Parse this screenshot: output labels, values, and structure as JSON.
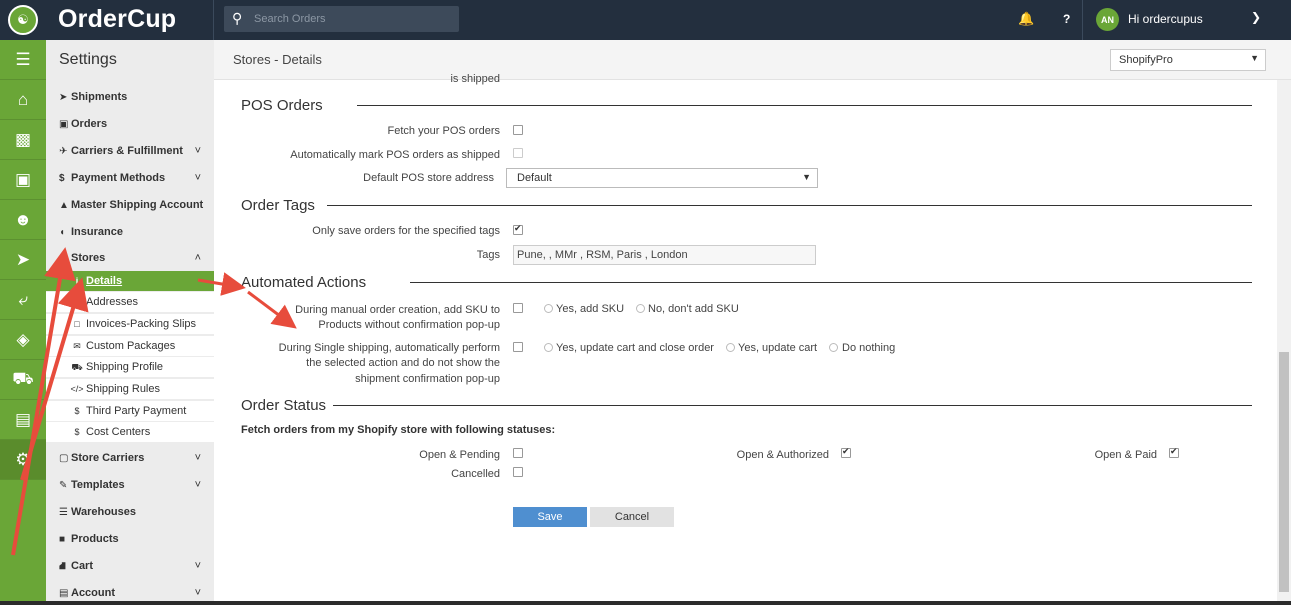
{
  "app": {
    "name": "OrderCup",
    "logo_glyph": "☯"
  },
  "topbar": {
    "search_placeholder": "Search Orders",
    "help": "?",
    "avatar": "AN",
    "greeting": "Hi ordercupus"
  },
  "icons": [
    "menu-icon",
    "home-icon",
    "money-icon",
    "archive-icon",
    "users-icon",
    "rocket-icon",
    "reply-icon",
    "tag-icon",
    "truck-icon",
    "chart-icon",
    "gear-icon"
  ],
  "settings": {
    "title": "Settings",
    "items": [
      {
        "icon": "➤",
        "label": "Shipments"
      },
      {
        "icon": "▣",
        "label": "Orders"
      },
      {
        "icon": "✈",
        "label": "Carriers & Fulfillment",
        "chev": "˅"
      },
      {
        "icon": "$",
        "label": "Payment Methods",
        "chev": "˅"
      },
      {
        "icon": "▲",
        "label": "Master Shipping Account"
      },
      {
        "icon": "◖",
        "label": "Insurance"
      },
      {
        "icon": "⌂",
        "label": "Stores",
        "chev": "˄"
      }
    ],
    "store_sub": [
      {
        "icon": "i",
        "label": "Details"
      },
      {
        "icon": "◆",
        "label": "Addresses"
      },
      {
        "icon": "□",
        "label": "Invoices-Packing Slips"
      },
      {
        "icon": "✉",
        "label": "Custom Packages"
      },
      {
        "icon": "⛟",
        "label": "Shipping Profile"
      },
      {
        "icon": "</>",
        "label": "Shipping Rules"
      },
      {
        "icon": "$",
        "label": "Third Party Payment"
      },
      {
        "icon": "$",
        "label": "Cost Centers"
      }
    ],
    "items2": [
      {
        "icon": "▢",
        "label": "Store Carriers",
        "chev": "˅"
      },
      {
        "icon": "✎",
        "label": "Templates",
        "chev": "˅"
      },
      {
        "icon": "☰",
        "label": "Warehouses"
      },
      {
        "icon": "■",
        "label": "Products"
      },
      {
        "icon": "⛘",
        "label": "Cart",
        "chev": "˅"
      },
      {
        "icon": "▤",
        "label": "Account",
        "chev": "˅"
      }
    ]
  },
  "header": {
    "breadcrumb": "Stores - Details",
    "store_select": "ShopifyPro"
  },
  "content": {
    "cut_text": "is shipped",
    "pos": {
      "title": "POS Orders",
      "fetch_label": "Fetch your POS orders",
      "auto_label": "Automatically mark POS orders as shipped",
      "default_label": "Default POS store address",
      "default_value": "Default"
    },
    "tags": {
      "title": "Order Tags",
      "only_label": "Only save orders for the specified tags",
      "tags_label": "Tags",
      "tags_value": "Pune, , MMr , RSM, Paris , London"
    },
    "auto": {
      "title": "Automated Actions",
      "manual_label_1": "During manual order creation, add SKU to",
      "manual_label_2": "Products without confirmation pop-up",
      "manual_yes": "Yes, add SKU",
      "manual_no": "No, don't add SKU",
      "single_label_1": "During Single shipping, automatically perform",
      "single_label_2": "the selected action and do not show the",
      "single_label_3": "shipment confirmation pop-up",
      "single_opt1": "Yes, update cart and close order",
      "single_opt2": "Yes, update cart",
      "single_opt3": "Do nothing"
    },
    "status": {
      "title": "Order Status",
      "fetch_label": "Fetch orders from my Shopify store with following statuses:",
      "open_pending": "Open & Pending",
      "open_authorized": "Open & Authorized",
      "open_paid": "Open & Paid",
      "cancelled": "Cancelled"
    },
    "buttons": {
      "save": "Save",
      "cancel": "Cancel"
    }
  },
  "colors": {
    "green": "#6aa637",
    "dark": "#232f3e",
    "arrow": "#e74c3c",
    "save_blue": "#4f8fd0"
  }
}
